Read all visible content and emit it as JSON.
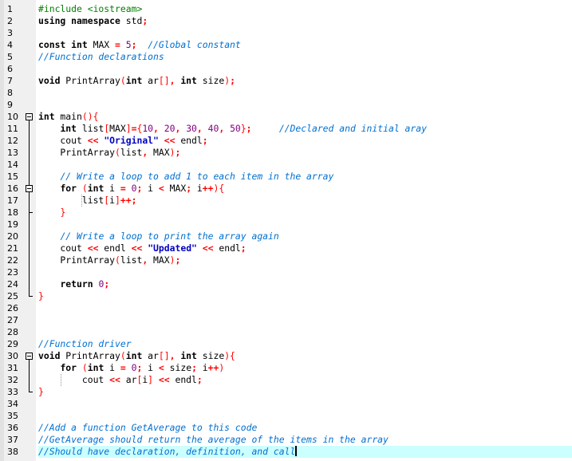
{
  "editor": {
    "current_line": 38,
    "lines": [
      {
        "n": "1",
        "tokens": [
          {
            "t": "pp",
            "v": "#include <iostream>"
          }
        ]
      },
      {
        "n": "2",
        "tokens": [
          {
            "t": "kw",
            "v": "using namespace"
          },
          {
            "t": "",
            "v": " std"
          },
          {
            "t": "op",
            "v": ";"
          }
        ]
      },
      {
        "n": "3",
        "tokens": []
      },
      {
        "n": "4",
        "tokens": [
          {
            "t": "kw",
            "v": "const int"
          },
          {
            "t": "",
            "v": " MAX "
          },
          {
            "t": "op",
            "v": "="
          },
          {
            "t": "",
            "v": " "
          },
          {
            "t": "num",
            "v": "5"
          },
          {
            "t": "op",
            "v": ";"
          },
          {
            "t": "",
            "v": "  "
          },
          {
            "t": "cm",
            "v": "//Global constant"
          }
        ]
      },
      {
        "n": "5",
        "tokens": [
          {
            "t": "cm",
            "v": "//Function declarations"
          }
        ]
      },
      {
        "n": "6",
        "tokens": []
      },
      {
        "n": "7",
        "tokens": [
          {
            "t": "kw",
            "v": "void"
          },
          {
            "t": "",
            "v": " PrintArray"
          },
          {
            "t": "br",
            "v": "("
          },
          {
            "t": "kw",
            "v": "int"
          },
          {
            "t": "",
            "v": " ar"
          },
          {
            "t": "br",
            "v": "[]"
          },
          {
            "t": "op",
            "v": ","
          },
          {
            "t": "",
            "v": " "
          },
          {
            "t": "kw",
            "v": "int"
          },
          {
            "t": "",
            "v": " size"
          },
          {
            "t": "br",
            "v": ")"
          },
          {
            "t": "op",
            "v": ";"
          }
        ]
      },
      {
        "n": "8",
        "tokens": []
      },
      {
        "n": "9",
        "tokens": []
      },
      {
        "n": "10",
        "tokens": [
          {
            "t": "kw",
            "v": "int"
          },
          {
            "t": "",
            "v": " main"
          },
          {
            "t": "br",
            "v": "(){"
          }
        ]
      },
      {
        "n": "11",
        "tokens": [
          {
            "t": "",
            "v": "    "
          },
          {
            "t": "kw",
            "v": "int"
          },
          {
            "t": "",
            "v": " list"
          },
          {
            "t": "br",
            "v": "["
          },
          {
            "t": "",
            "v": "MAX"
          },
          {
            "t": "br",
            "v": "]"
          },
          {
            "t": "op",
            "v": "="
          },
          {
            "t": "br",
            "v": "{"
          },
          {
            "t": "num",
            "v": "10"
          },
          {
            "t": "op",
            "v": ","
          },
          {
            "t": "",
            "v": " "
          },
          {
            "t": "num",
            "v": "20"
          },
          {
            "t": "op",
            "v": ","
          },
          {
            "t": "",
            "v": " "
          },
          {
            "t": "num",
            "v": "30"
          },
          {
            "t": "op",
            "v": ","
          },
          {
            "t": "",
            "v": " "
          },
          {
            "t": "num",
            "v": "40"
          },
          {
            "t": "op",
            "v": ","
          },
          {
            "t": "",
            "v": " "
          },
          {
            "t": "num",
            "v": "50"
          },
          {
            "t": "br",
            "v": "}"
          },
          {
            "t": "op",
            "v": ";"
          },
          {
            "t": "",
            "v": "     "
          },
          {
            "t": "cm",
            "v": "//Declared and initial aray"
          }
        ]
      },
      {
        "n": "12",
        "tokens": [
          {
            "t": "",
            "v": "    cout "
          },
          {
            "t": "op",
            "v": "<<"
          },
          {
            "t": "",
            "v": " "
          },
          {
            "t": "str",
            "v": "\"Original\""
          },
          {
            "t": "",
            "v": " "
          },
          {
            "t": "op",
            "v": "<<"
          },
          {
            "t": "",
            "v": " endl"
          },
          {
            "t": "op",
            "v": ";"
          }
        ]
      },
      {
        "n": "13",
        "tokens": [
          {
            "t": "",
            "v": "    PrintArray"
          },
          {
            "t": "br",
            "v": "("
          },
          {
            "t": "",
            "v": "list"
          },
          {
            "t": "op",
            "v": ","
          },
          {
            "t": "",
            "v": " MAX"
          },
          {
            "t": "br",
            "v": ")"
          },
          {
            "t": "op",
            "v": ";"
          }
        ]
      },
      {
        "n": "14",
        "tokens": []
      },
      {
        "n": "15",
        "tokens": [
          {
            "t": "",
            "v": "    "
          },
          {
            "t": "cm",
            "v": "// Write a loop to add 1 to each item in the array"
          }
        ]
      },
      {
        "n": "16",
        "tokens": [
          {
            "t": "",
            "v": "    "
          },
          {
            "t": "kw",
            "v": "for"
          },
          {
            "t": "",
            "v": " "
          },
          {
            "t": "br",
            "v": "("
          },
          {
            "t": "kw",
            "v": "int"
          },
          {
            "t": "",
            "v": " i "
          },
          {
            "t": "op",
            "v": "="
          },
          {
            "t": "",
            "v": " "
          },
          {
            "t": "num",
            "v": "0"
          },
          {
            "t": "op",
            "v": ";"
          },
          {
            "t": "",
            "v": " i "
          },
          {
            "t": "op",
            "v": "<"
          },
          {
            "t": "",
            "v": " MAX"
          },
          {
            "t": "op",
            "v": ";"
          },
          {
            "t": "",
            "v": " i"
          },
          {
            "t": "op",
            "v": "++"
          },
          {
            "t": "br",
            "v": "){"
          }
        ]
      },
      {
        "n": "17",
        "tokens": [
          {
            "t": "",
            "v": "        list"
          },
          {
            "t": "br",
            "v": "["
          },
          {
            "t": "",
            "v": "i"
          },
          {
            "t": "br",
            "v": "]"
          },
          {
            "t": "op",
            "v": "++;"
          }
        ]
      },
      {
        "n": "18",
        "tokens": [
          {
            "t": "",
            "v": "    "
          },
          {
            "t": "br",
            "v": "}"
          }
        ]
      },
      {
        "n": "19",
        "tokens": []
      },
      {
        "n": "20",
        "tokens": [
          {
            "t": "",
            "v": "    "
          },
          {
            "t": "cm",
            "v": "// Write a loop to print the array again"
          }
        ]
      },
      {
        "n": "21",
        "tokens": [
          {
            "t": "",
            "v": "    cout "
          },
          {
            "t": "op",
            "v": "<<"
          },
          {
            "t": "",
            "v": " endl "
          },
          {
            "t": "op",
            "v": "<<"
          },
          {
            "t": "",
            "v": " "
          },
          {
            "t": "str",
            "v": "\"Updated\""
          },
          {
            "t": "",
            "v": " "
          },
          {
            "t": "op",
            "v": "<<"
          },
          {
            "t": "",
            "v": " endl"
          },
          {
            "t": "op",
            "v": ";"
          }
        ]
      },
      {
        "n": "22",
        "tokens": [
          {
            "t": "",
            "v": "    PrintArray"
          },
          {
            "t": "br",
            "v": "("
          },
          {
            "t": "",
            "v": "list"
          },
          {
            "t": "op",
            "v": ","
          },
          {
            "t": "",
            "v": " MAX"
          },
          {
            "t": "br",
            "v": ")"
          },
          {
            "t": "op",
            "v": ";"
          }
        ]
      },
      {
        "n": "23",
        "tokens": []
      },
      {
        "n": "24",
        "tokens": [
          {
            "t": "",
            "v": "    "
          },
          {
            "t": "kw",
            "v": "return"
          },
          {
            "t": "",
            "v": " "
          },
          {
            "t": "num",
            "v": "0"
          },
          {
            "t": "op",
            "v": ";"
          }
        ]
      },
      {
        "n": "25",
        "tokens": [
          {
            "t": "br",
            "v": "}"
          }
        ]
      },
      {
        "n": "26",
        "tokens": []
      },
      {
        "n": "27",
        "tokens": []
      },
      {
        "n": "28",
        "tokens": []
      },
      {
        "n": "29",
        "tokens": [
          {
            "t": "cm",
            "v": "//Function driver"
          }
        ]
      },
      {
        "n": "30",
        "tokens": [
          {
            "t": "kw",
            "v": "void"
          },
          {
            "t": "",
            "v": " PrintArray"
          },
          {
            "t": "br",
            "v": "("
          },
          {
            "t": "kw",
            "v": "int"
          },
          {
            "t": "",
            "v": " ar"
          },
          {
            "t": "br",
            "v": "[]"
          },
          {
            "t": "op",
            "v": ","
          },
          {
            "t": "",
            "v": " "
          },
          {
            "t": "kw",
            "v": "int"
          },
          {
            "t": "",
            "v": " size"
          },
          {
            "t": "br",
            "v": "){"
          }
        ]
      },
      {
        "n": "31",
        "tokens": [
          {
            "t": "",
            "v": "    "
          },
          {
            "t": "kw",
            "v": "for"
          },
          {
            "t": "",
            "v": " "
          },
          {
            "t": "br",
            "v": "("
          },
          {
            "t": "kw",
            "v": "int"
          },
          {
            "t": "",
            "v": " i "
          },
          {
            "t": "op",
            "v": "="
          },
          {
            "t": "",
            "v": " "
          },
          {
            "t": "num",
            "v": "0"
          },
          {
            "t": "op",
            "v": ";"
          },
          {
            "t": "",
            "v": " i "
          },
          {
            "t": "op",
            "v": "<"
          },
          {
            "t": "",
            "v": " size"
          },
          {
            "t": "op",
            "v": ";"
          },
          {
            "t": "",
            "v": " i"
          },
          {
            "t": "op",
            "v": "++"
          },
          {
            "t": "br",
            "v": ")"
          }
        ]
      },
      {
        "n": "32",
        "tokens": [
          {
            "t": "",
            "v": "        cout "
          },
          {
            "t": "op",
            "v": "<<"
          },
          {
            "t": "",
            "v": " ar"
          },
          {
            "t": "br",
            "v": "["
          },
          {
            "t": "",
            "v": "i"
          },
          {
            "t": "br",
            "v": "]"
          },
          {
            "t": "",
            "v": " "
          },
          {
            "t": "op",
            "v": "<<"
          },
          {
            "t": "",
            "v": " endl"
          },
          {
            "t": "op",
            "v": ";"
          }
        ]
      },
      {
        "n": "33",
        "tokens": [
          {
            "t": "br",
            "v": "}"
          }
        ]
      },
      {
        "n": "34",
        "tokens": []
      },
      {
        "n": "35",
        "tokens": []
      },
      {
        "n": "36",
        "tokens": [
          {
            "t": "cm",
            "v": "//Add a function GetAverage to this code"
          }
        ]
      },
      {
        "n": "37",
        "tokens": [
          {
            "t": "cm",
            "v": "//GetAverage should return the average of the items in the array"
          }
        ]
      },
      {
        "n": "38",
        "tokens": [
          {
            "t": "cm",
            "v": "//Should have declaration, definition, and call"
          }
        ]
      }
    ],
    "fold_markers": [
      {
        "start": 10,
        "end": 25
      },
      {
        "start": 16,
        "end": 18
      },
      {
        "start": 30,
        "end": 33
      }
    ]
  }
}
